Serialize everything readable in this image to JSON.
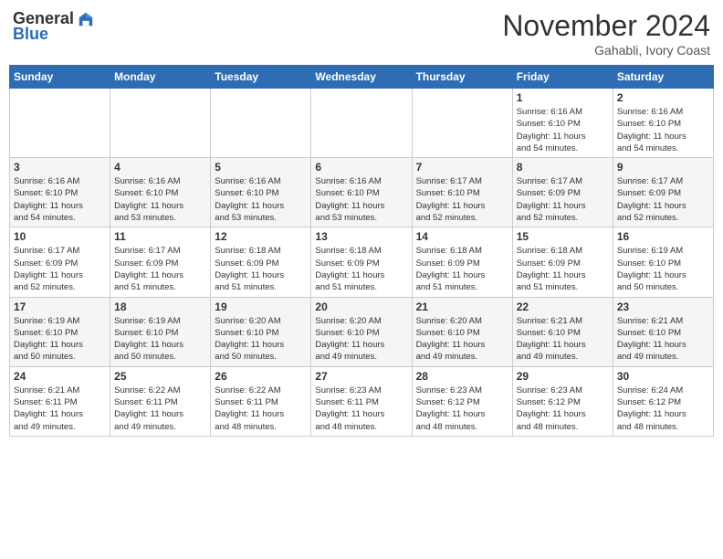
{
  "header": {
    "logo_general": "General",
    "logo_blue": "Blue",
    "title": "November 2024",
    "location": "Gahabli, Ivory Coast"
  },
  "weekdays": [
    "Sunday",
    "Monday",
    "Tuesday",
    "Wednesday",
    "Thursday",
    "Friday",
    "Saturday"
  ],
  "weeks": [
    [
      {
        "day": "",
        "info": ""
      },
      {
        "day": "",
        "info": ""
      },
      {
        "day": "",
        "info": ""
      },
      {
        "day": "",
        "info": ""
      },
      {
        "day": "",
        "info": ""
      },
      {
        "day": "1",
        "info": "Sunrise: 6:16 AM\nSunset: 6:10 PM\nDaylight: 11 hours\nand 54 minutes."
      },
      {
        "day": "2",
        "info": "Sunrise: 6:16 AM\nSunset: 6:10 PM\nDaylight: 11 hours\nand 54 minutes."
      }
    ],
    [
      {
        "day": "3",
        "info": "Sunrise: 6:16 AM\nSunset: 6:10 PM\nDaylight: 11 hours\nand 54 minutes."
      },
      {
        "day": "4",
        "info": "Sunrise: 6:16 AM\nSunset: 6:10 PM\nDaylight: 11 hours\nand 53 minutes."
      },
      {
        "day": "5",
        "info": "Sunrise: 6:16 AM\nSunset: 6:10 PM\nDaylight: 11 hours\nand 53 minutes."
      },
      {
        "day": "6",
        "info": "Sunrise: 6:16 AM\nSunset: 6:10 PM\nDaylight: 11 hours\nand 53 minutes."
      },
      {
        "day": "7",
        "info": "Sunrise: 6:17 AM\nSunset: 6:10 PM\nDaylight: 11 hours\nand 52 minutes."
      },
      {
        "day": "8",
        "info": "Sunrise: 6:17 AM\nSunset: 6:09 PM\nDaylight: 11 hours\nand 52 minutes."
      },
      {
        "day": "9",
        "info": "Sunrise: 6:17 AM\nSunset: 6:09 PM\nDaylight: 11 hours\nand 52 minutes."
      }
    ],
    [
      {
        "day": "10",
        "info": "Sunrise: 6:17 AM\nSunset: 6:09 PM\nDaylight: 11 hours\nand 52 minutes."
      },
      {
        "day": "11",
        "info": "Sunrise: 6:17 AM\nSunset: 6:09 PM\nDaylight: 11 hours\nand 51 minutes."
      },
      {
        "day": "12",
        "info": "Sunrise: 6:18 AM\nSunset: 6:09 PM\nDaylight: 11 hours\nand 51 minutes."
      },
      {
        "day": "13",
        "info": "Sunrise: 6:18 AM\nSunset: 6:09 PM\nDaylight: 11 hours\nand 51 minutes."
      },
      {
        "day": "14",
        "info": "Sunrise: 6:18 AM\nSunset: 6:09 PM\nDaylight: 11 hours\nand 51 minutes."
      },
      {
        "day": "15",
        "info": "Sunrise: 6:18 AM\nSunset: 6:09 PM\nDaylight: 11 hours\nand 51 minutes."
      },
      {
        "day": "16",
        "info": "Sunrise: 6:19 AM\nSunset: 6:10 PM\nDaylight: 11 hours\nand 50 minutes."
      }
    ],
    [
      {
        "day": "17",
        "info": "Sunrise: 6:19 AM\nSunset: 6:10 PM\nDaylight: 11 hours\nand 50 minutes."
      },
      {
        "day": "18",
        "info": "Sunrise: 6:19 AM\nSunset: 6:10 PM\nDaylight: 11 hours\nand 50 minutes."
      },
      {
        "day": "19",
        "info": "Sunrise: 6:20 AM\nSunset: 6:10 PM\nDaylight: 11 hours\nand 50 minutes."
      },
      {
        "day": "20",
        "info": "Sunrise: 6:20 AM\nSunset: 6:10 PM\nDaylight: 11 hours\nand 49 minutes."
      },
      {
        "day": "21",
        "info": "Sunrise: 6:20 AM\nSunset: 6:10 PM\nDaylight: 11 hours\nand 49 minutes."
      },
      {
        "day": "22",
        "info": "Sunrise: 6:21 AM\nSunset: 6:10 PM\nDaylight: 11 hours\nand 49 minutes."
      },
      {
        "day": "23",
        "info": "Sunrise: 6:21 AM\nSunset: 6:10 PM\nDaylight: 11 hours\nand 49 minutes."
      }
    ],
    [
      {
        "day": "24",
        "info": "Sunrise: 6:21 AM\nSunset: 6:11 PM\nDaylight: 11 hours\nand 49 minutes."
      },
      {
        "day": "25",
        "info": "Sunrise: 6:22 AM\nSunset: 6:11 PM\nDaylight: 11 hours\nand 49 minutes."
      },
      {
        "day": "26",
        "info": "Sunrise: 6:22 AM\nSunset: 6:11 PM\nDaylight: 11 hours\nand 48 minutes."
      },
      {
        "day": "27",
        "info": "Sunrise: 6:23 AM\nSunset: 6:11 PM\nDaylight: 11 hours\nand 48 minutes."
      },
      {
        "day": "28",
        "info": "Sunrise: 6:23 AM\nSunset: 6:12 PM\nDaylight: 11 hours\nand 48 minutes."
      },
      {
        "day": "29",
        "info": "Sunrise: 6:23 AM\nSunset: 6:12 PM\nDaylight: 11 hours\nand 48 minutes."
      },
      {
        "day": "30",
        "info": "Sunrise: 6:24 AM\nSunset: 6:12 PM\nDaylight: 11 hours\nand 48 minutes."
      }
    ]
  ]
}
